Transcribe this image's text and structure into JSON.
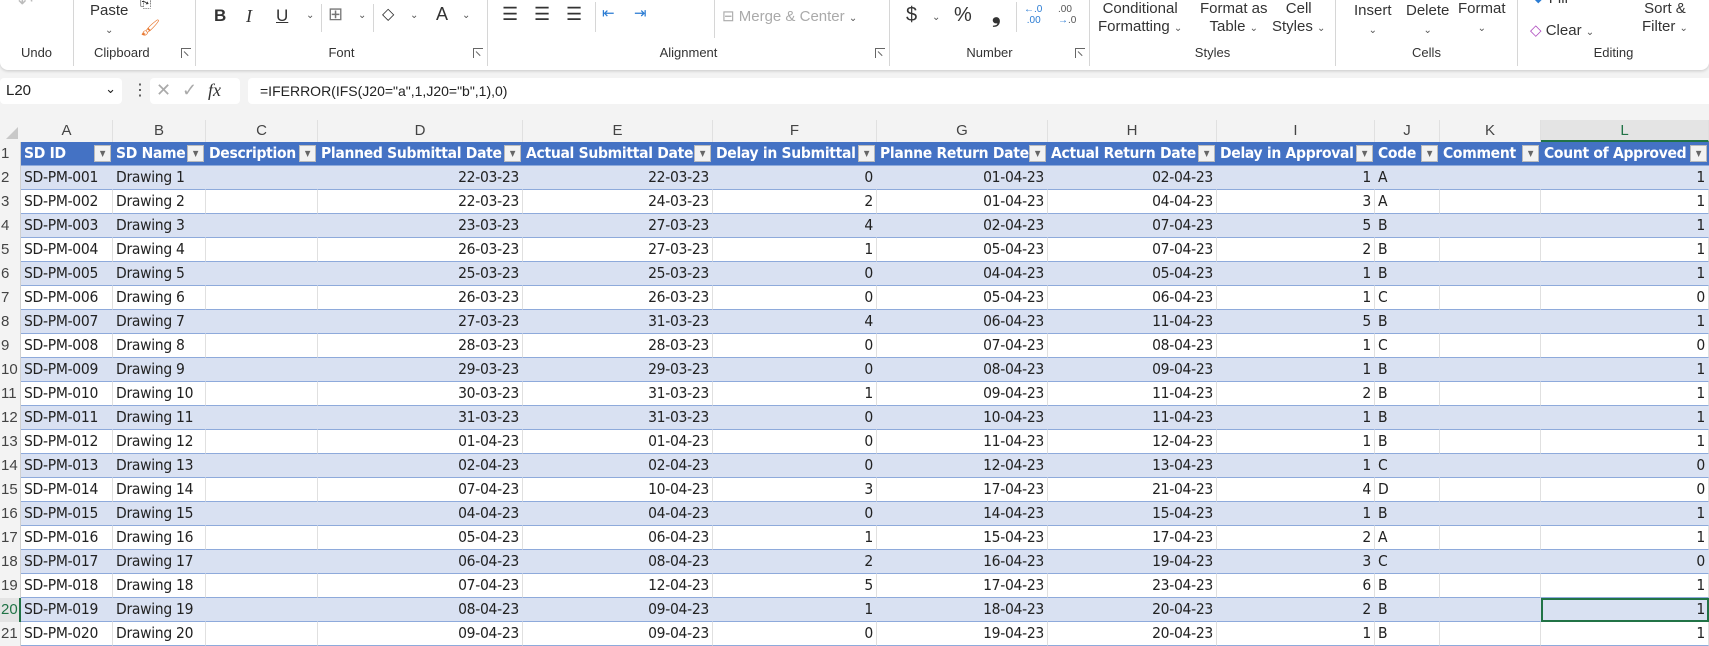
{
  "ribbon": {
    "groups": {
      "undo": "Undo",
      "clipboard": "Clipboard",
      "font": "Font",
      "alignment": "Alignment",
      "number": "Number",
      "styles": "Styles",
      "cells": "Cells",
      "editing": "Editing"
    },
    "paste": "Paste",
    "bold": "B",
    "italic": "I",
    "underline": "U",
    "font_color": "A",
    "merge_center": "Merge & Center",
    "currency": "$",
    "percent": "%",
    "comma": "9",
    "increase_decimal": "←.0 .00",
    "decrease_decimal": ".00 →.0",
    "conditional_formatting": [
      "Conditional",
      "Formatting"
    ],
    "format_as_table": [
      "Format as",
      "Table"
    ],
    "cell_styles": [
      "Cell",
      "Styles"
    ],
    "insert": "Insert",
    "delete": "Delete",
    "format": "Format",
    "fill": "Fill",
    "clear": "Clear",
    "sort_filter": [
      "Sort &",
      "Filter"
    ]
  },
  "formula_bar": {
    "name_box": "L20",
    "fx": "fx",
    "formula": "=IFERROR(IFS(J20=\"a\",1,J20=\"b\",1),0)"
  },
  "sheet": {
    "column_letters": [
      "A",
      "B",
      "C",
      "D",
      "E",
      "F",
      "G",
      "H",
      "I",
      "J",
      "K",
      "L"
    ],
    "selected_column": "L",
    "selected_row": 20,
    "headers": [
      "SD ID",
      "SD Name",
      "Description",
      "Planned Submittal Date",
      "Actual Submittal Date",
      "Delay in Submittal",
      "Planne Return Date",
      "Actual Return Date",
      "Delay in Approval",
      "Code",
      "Comment",
      "Count of Approved"
    ],
    "rows": [
      [
        "SD-PM-001",
        "Drawing 1",
        "",
        "22-03-23",
        "22-03-23",
        "0",
        "01-04-23",
        "02-04-23",
        "1",
        "A",
        "",
        "1"
      ],
      [
        "SD-PM-002",
        "Drawing 2",
        "",
        "22-03-23",
        "24-03-23",
        "2",
        "01-04-23",
        "04-04-23",
        "3",
        "A",
        "",
        "1"
      ],
      [
        "SD-PM-003",
        "Drawing 3",
        "",
        "23-03-23",
        "27-03-23",
        "4",
        "02-04-23",
        "07-04-23",
        "5",
        "B",
        "",
        "1"
      ],
      [
        "SD-PM-004",
        "Drawing 4",
        "",
        "26-03-23",
        "27-03-23",
        "1",
        "05-04-23",
        "07-04-23",
        "2",
        "B",
        "",
        "1"
      ],
      [
        "SD-PM-005",
        "Drawing 5",
        "",
        "25-03-23",
        "25-03-23",
        "0",
        "04-04-23",
        "05-04-23",
        "1",
        "B",
        "",
        "1"
      ],
      [
        "SD-PM-006",
        "Drawing 6",
        "",
        "26-03-23",
        "26-03-23",
        "0",
        "05-04-23",
        "06-04-23",
        "1",
        "C",
        "",
        "0"
      ],
      [
        "SD-PM-007",
        "Drawing 7",
        "",
        "27-03-23",
        "31-03-23",
        "4",
        "06-04-23",
        "11-04-23",
        "5",
        "B",
        "",
        "1"
      ],
      [
        "SD-PM-008",
        "Drawing 8",
        "",
        "28-03-23",
        "28-03-23",
        "0",
        "07-04-23",
        "08-04-23",
        "1",
        "C",
        "",
        "0"
      ],
      [
        "SD-PM-009",
        "Drawing 9",
        "",
        "29-03-23",
        "29-03-23",
        "0",
        "08-04-23",
        "09-04-23",
        "1",
        "B",
        "",
        "1"
      ],
      [
        "SD-PM-010",
        "Drawing 10",
        "",
        "30-03-23",
        "31-03-23",
        "1",
        "09-04-23",
        "11-04-23",
        "2",
        "B",
        "",
        "1"
      ],
      [
        "SD-PM-011",
        "Drawing 11",
        "",
        "31-03-23",
        "31-03-23",
        "0",
        "10-04-23",
        "11-04-23",
        "1",
        "B",
        "",
        "1"
      ],
      [
        "SD-PM-012",
        "Drawing 12",
        "",
        "01-04-23",
        "01-04-23",
        "0",
        "11-04-23",
        "12-04-23",
        "1",
        "B",
        "",
        "1"
      ],
      [
        "SD-PM-013",
        "Drawing 13",
        "",
        "02-04-23",
        "02-04-23",
        "0",
        "12-04-23",
        "13-04-23",
        "1",
        "C",
        "",
        "0"
      ],
      [
        "SD-PM-014",
        "Drawing 14",
        "",
        "07-04-23",
        "10-04-23",
        "3",
        "17-04-23",
        "21-04-23",
        "4",
        "D",
        "",
        "0"
      ],
      [
        "SD-PM-015",
        "Drawing 15",
        "",
        "04-04-23",
        "04-04-23",
        "0",
        "14-04-23",
        "15-04-23",
        "1",
        "B",
        "",
        "1"
      ],
      [
        "SD-PM-016",
        "Drawing 16",
        "",
        "05-04-23",
        "06-04-23",
        "1",
        "15-04-23",
        "17-04-23",
        "2",
        "A",
        "",
        "1"
      ],
      [
        "SD-PM-017",
        "Drawing 17",
        "",
        "06-04-23",
        "08-04-23",
        "2",
        "16-04-23",
        "19-04-23",
        "3",
        "C",
        "",
        "0"
      ],
      [
        "SD-PM-018",
        "Drawing 18",
        "",
        "07-04-23",
        "12-04-23",
        "5",
        "17-04-23",
        "23-04-23",
        "6",
        "B",
        "",
        "1"
      ],
      [
        "SD-PM-019",
        "Drawing 19",
        "",
        "08-04-23",
        "09-04-23",
        "1",
        "18-04-23",
        "20-04-23",
        "2",
        "B",
        "",
        "1"
      ],
      [
        "SD-PM-020",
        "Drawing 20",
        "",
        "09-04-23",
        "09-04-23",
        "0",
        "19-04-23",
        "20-04-23",
        "1",
        "B",
        "",
        "1"
      ]
    ]
  },
  "colors": {
    "table_header": "#4472c4",
    "band_row": "#d9e1f2",
    "selection": "#217346"
  }
}
